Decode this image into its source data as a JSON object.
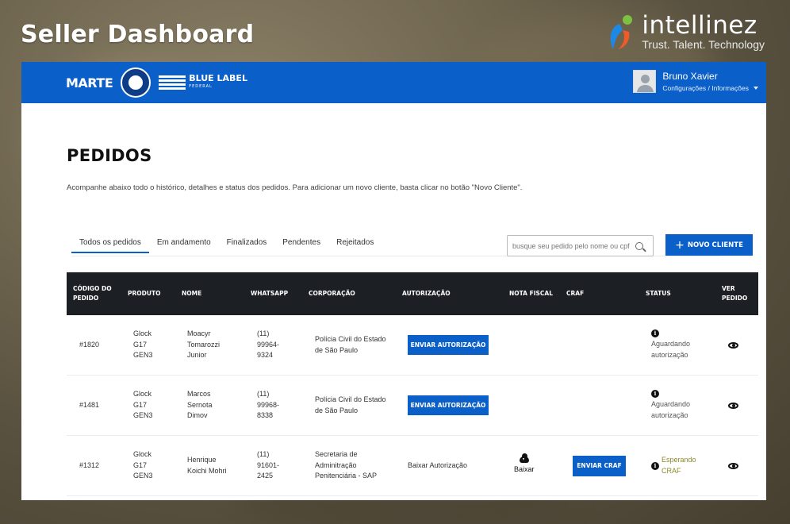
{
  "slide": {
    "title": "Seller Dashboard",
    "brand_name": "intellinez",
    "brand_tagline": "Trust. Talent. Technology"
  },
  "header": {
    "logo_marte": "MARTE",
    "logo_bluelabel": "BLUE LABEL",
    "logo_bluelabel_sub": "FEDERAL",
    "user_name": "Bruno Xavier",
    "user_menu": "Configurações / Informações"
  },
  "page": {
    "title": "PEDIDOS",
    "description": "Acompanhe abaixo todo o histórico, detalhes e status dos pedidos. Para adicionar um novo cliente, basta clicar no botão \"Novo Cliente\"."
  },
  "tabs": [
    {
      "label": "Todos os pedidos",
      "active": true
    },
    {
      "label": "Em andamento",
      "active": false
    },
    {
      "label": "Finalizados",
      "active": false
    },
    {
      "label": "Pendentes",
      "active": false
    },
    {
      "label": "Rejeitados",
      "active": false
    }
  ],
  "search": {
    "placeholder": "busque seu pedido pelo nome ou cpf"
  },
  "new_client_button": "NOVO CLIENTE",
  "table": {
    "headers": {
      "codigo": "CÓDIGO DO PEDIDO",
      "produto": "PRODUTO",
      "nome": "NOME",
      "whatsapp": "WHATSAPP",
      "corporacao": "CORPORAÇÃO",
      "autorizacao": "AUTORIZAÇÃO",
      "nota_fiscal": "NOTA FISCAL",
      "craf": "CRAF",
      "status": "STATUS",
      "ver_pedido": "VER PEDIDO"
    },
    "rows": [
      {
        "codigo": "#1820",
        "produto": "Glock G17 GEN3",
        "nome": "Moacyr Tomarozzi Junior",
        "whatsapp": "(11) 99964-9324",
        "corporacao": "Polícia Civil do Estado de São Paulo",
        "autorizacao_button": "ENVIAR AUTORIZAÇÃO",
        "status": "Aguardando autorização"
      },
      {
        "codigo": "#1481",
        "produto": "Glock G17 GEN3",
        "nome": "Marcos Sernota Dimov",
        "whatsapp": "(11) 99968-8338",
        "corporacao": "Polícia Civil do Estado de São Paulo",
        "autorizacao_button": "ENVIAR AUTORIZAÇÃO",
        "status": "Aguardando autorização"
      },
      {
        "codigo": "#1312",
        "produto": "Glock G17 GEN3",
        "nome": "Henrique Koichi Mohri",
        "whatsapp": "(11) 91601-2425",
        "corporacao": "Secretaria de Adminitração Penitenciária - SAP",
        "autorizacao_text": "Baixar Autorização",
        "nota_fiscal": "Baixar",
        "craf_button": "ENVIAR CRAF",
        "status": "Esperando CRAF"
      }
    ]
  },
  "colors": {
    "primary": "#0b5fc8",
    "table_header": "#1c1f24",
    "status_waiting_craf": "#8a8a2a"
  },
  "icons": [
    "search-icon",
    "plus-icon",
    "info-icon",
    "eye-icon",
    "cloud-download-icon",
    "chevron-down-icon",
    "avatar-icon"
  ]
}
